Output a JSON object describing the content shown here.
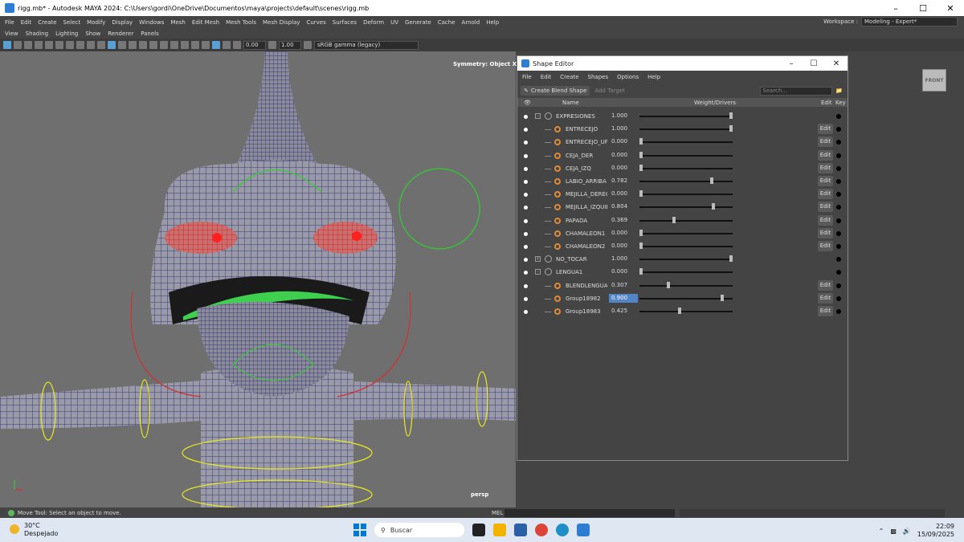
{
  "window": {
    "title": "rigg.mb* - Autodesk MAYA 2024: C:\\Users\\gordi\\OneDrive\\Documentos\\maya\\projects\\default\\scenes\\rigg.mb"
  },
  "menubar": [
    "File",
    "Edit",
    "Create",
    "Select",
    "Modify",
    "Display",
    "Windows",
    "Mesh",
    "Edit Mesh",
    "Mesh Tools",
    "Mesh Display",
    "Curves",
    "Surfaces",
    "Deform",
    "UV",
    "Generate",
    "Cache",
    "Arnold",
    "Help"
  ],
  "workspace": {
    "label": "Workspace :",
    "value": "Modeling - Expert*"
  },
  "panel_menu": [
    "View",
    "Shading",
    "Lighting",
    "Show",
    "Renderer",
    "Panels"
  ],
  "iconbar": {
    "value1": "0.00",
    "value2": "1.00",
    "colorspace": "sRGB gamma (legacy)"
  },
  "viewport": {
    "symmetry": "Symmetry: Object X",
    "camera": "persp",
    "viewcube": "FRONT"
  },
  "shape_editor": {
    "title": "Shape Editor",
    "menu": [
      "File",
      "Edit",
      "Create",
      "Shapes",
      "Options",
      "Help"
    ],
    "create_blend": "Create Blend Shape",
    "add_target": "Add Target",
    "search_placeholder": "Search...",
    "headers": {
      "name": "Name",
      "weight": "Weight/Drivers",
      "edit": "Edit",
      "key": "Key"
    },
    "edit_label": "Edit",
    "rows": [
      {
        "name": "EXPRESIONES",
        "value": "1.000",
        "weight": 1.0,
        "type": "group"
      },
      {
        "name": "ENTRECEJO",
        "value": "1.000",
        "weight": 1.0,
        "type": "target"
      },
      {
        "name": "ENTRECEJO_UP",
        "value": "0.000",
        "weight": 0.0,
        "type": "target"
      },
      {
        "name": "CEJA_DER",
        "value": "0.000",
        "weight": 0.0,
        "type": "target"
      },
      {
        "name": "CEJA_IZQ",
        "value": "0.000",
        "weight": 0.0,
        "type": "target"
      },
      {
        "name": "LABIO_ARRIBA",
        "value": "0.782",
        "weight": 0.782,
        "type": "target"
      },
      {
        "name": "MEJILLA_DERECH",
        "value": "0.000",
        "weight": 0.0,
        "type": "target"
      },
      {
        "name": "MEJILLA_IZQUIER",
        "value": "0.804",
        "weight": 0.804,
        "type": "target"
      },
      {
        "name": "PAPADA",
        "value": "0.369",
        "weight": 0.369,
        "type": "target"
      },
      {
        "name": "CHAMALEON1",
        "value": "0.000",
        "weight": 0.0,
        "type": "target"
      },
      {
        "name": "CHAMALEON2",
        "value": "0.000",
        "weight": 0.0,
        "type": "target"
      },
      {
        "name": "NO_TOCAR",
        "value": "1.000",
        "weight": 1.0,
        "type": "group",
        "collapsed": true
      },
      {
        "name": "LENGUA1",
        "value": "0.000",
        "weight": 0.0,
        "type": "group"
      },
      {
        "name": "BLENDLENGUA",
        "value": "0.307",
        "weight": 0.307,
        "type": "target"
      },
      {
        "name": "Group18982",
        "value": "0.900",
        "weight": 0.9,
        "type": "target",
        "selected": true
      },
      {
        "name": "Group18983",
        "value": "0.425",
        "weight": 0.425,
        "type": "target"
      }
    ]
  },
  "cmdline": {
    "help": "Move Tool: Select an object to move.",
    "mel": "MEL"
  },
  "taskbar": {
    "temp": "30°C",
    "weather": "Despejado",
    "search": "Buscar",
    "time": "22:09",
    "date": "15/09/2025"
  }
}
